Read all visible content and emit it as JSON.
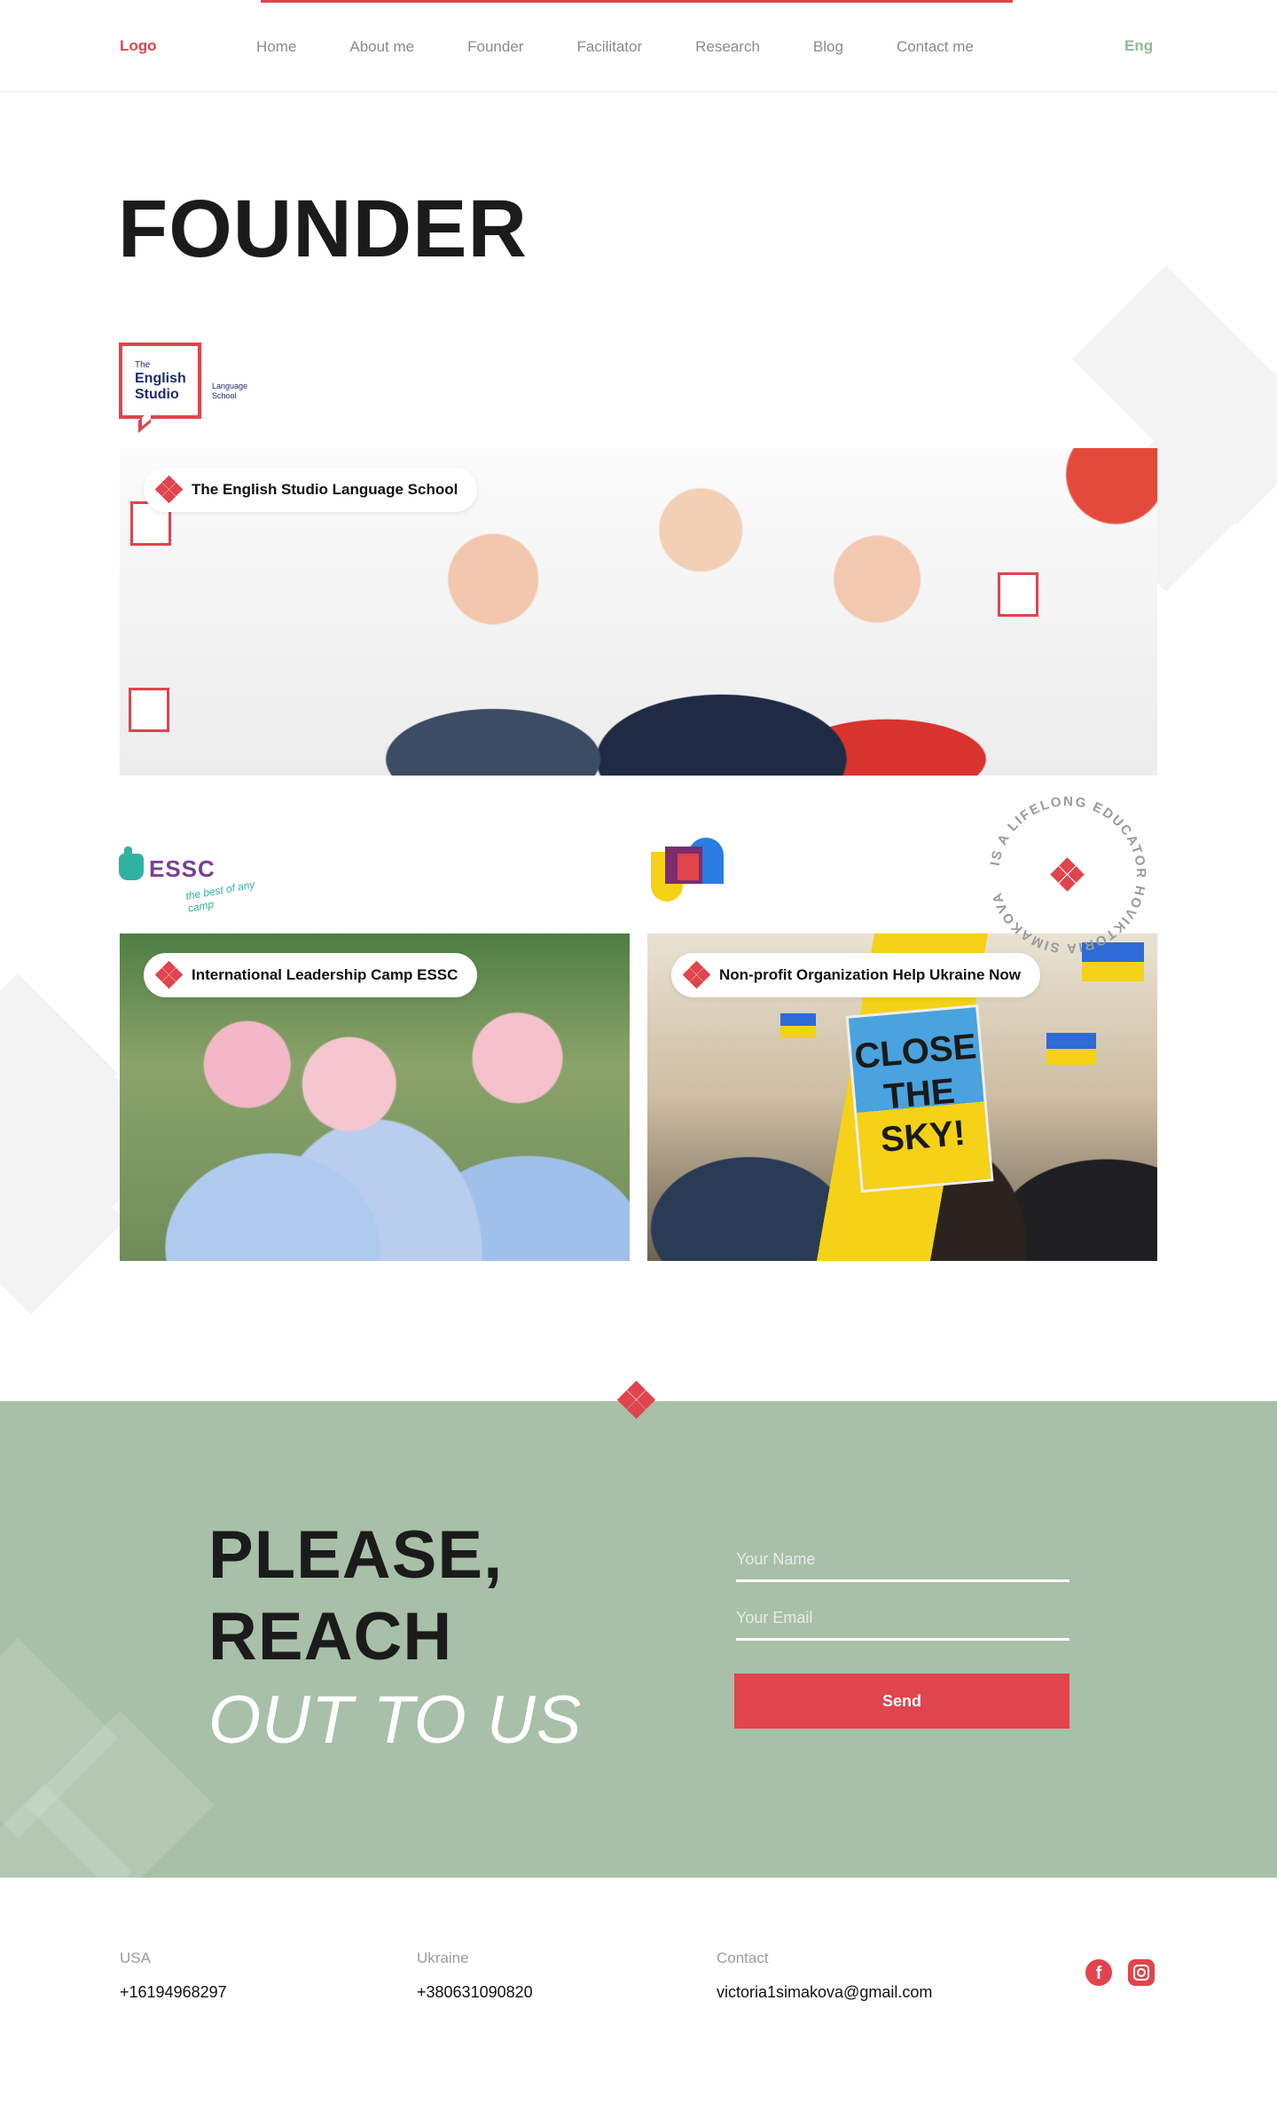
{
  "nav": {
    "logo": "Logo",
    "links": [
      "Home",
      "About me",
      "Founder",
      "Facilitator",
      "Research",
      "Blog",
      "Contact me"
    ],
    "lang": "Eng",
    "accent_color": "#e0444d"
  },
  "page": {
    "title": "FOUNDER"
  },
  "logos": {
    "school_small": "The",
    "school_name": "English Studio",
    "school_side": "Language School",
    "camp_name": "ESSC",
    "camp_tagline": "the best of any camp"
  },
  "cards": [
    {
      "label": "The English Studio Language School"
    },
    {
      "label": "International Leadership Camp ESSC"
    },
    {
      "label": "Non-profit Organization Help Ukraine Now"
    }
  ],
  "photo_text": {
    "sign": "CLOSE THE SKY!"
  },
  "badge": {
    "text": "IS A LIFELONG EDUCATOR HOVIKTORIA SIMAKOVA"
  },
  "contact": {
    "line1": "PLEASE,",
    "line2": "REACH",
    "line3": "OUT TO US",
    "name_placeholder": "Your Name",
    "email_placeholder": "Your Email",
    "send_label": "Send",
    "background_color": "#a8bfa8"
  },
  "footer": {
    "usa_label": "USA",
    "usa_phone": "+16194968297",
    "ukraine_label": "Ukraine",
    "ukraine_phone": "+380631090820",
    "contact_label": "Contact",
    "email": "victoria1simakova@gmail.com",
    "social": [
      "facebook-icon",
      "instagram-icon"
    ]
  }
}
